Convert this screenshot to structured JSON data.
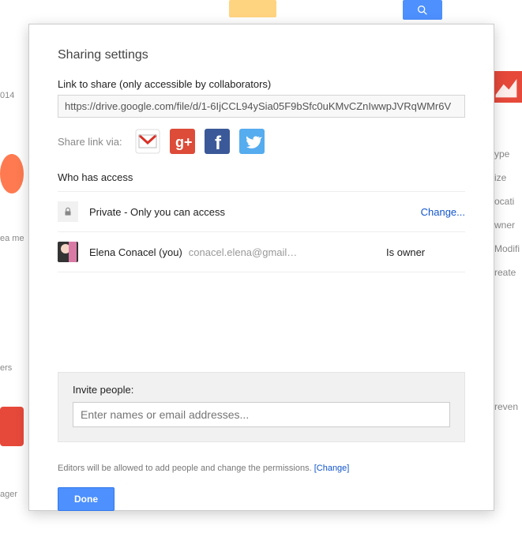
{
  "bg": {
    "side": [
      "ype",
      "ize",
      "ocati",
      "wner",
      "Modifi",
      "reate",
      "reven",
      "ager"
    ],
    "year": "014",
    "ea": "ea me",
    "ers": "ers"
  },
  "dialog": {
    "title": "Sharing settings",
    "link_label": "Link to share (only accessible by collaborators)",
    "link_value": "https://drive.google.com/file/d/1-6IjCCL94ySia05F9bSfc0uKMvCZnIwwpJVRqWMr6V",
    "share_via_label": "Share link via:",
    "icons": {
      "gmail": "gmail-icon",
      "gplus": "google-plus-icon",
      "fb": "facebook-icon",
      "tw": "twitter-icon"
    },
    "who_label": "Who has access",
    "access": [
      {
        "kind": "lock",
        "text": "Private - Only you can access",
        "action": "Change..."
      },
      {
        "kind": "user",
        "name": "Elena Conacel (you)",
        "email": "conacel.elena@gmail…",
        "role": "Is owner"
      }
    ],
    "invite_label": "Invite people:",
    "invite_placeholder": "Enter names or email addresses...",
    "editors_note": "Editors will be allowed to add people and change the permissions.  ",
    "editors_change": "[Change]",
    "done": "Done"
  }
}
